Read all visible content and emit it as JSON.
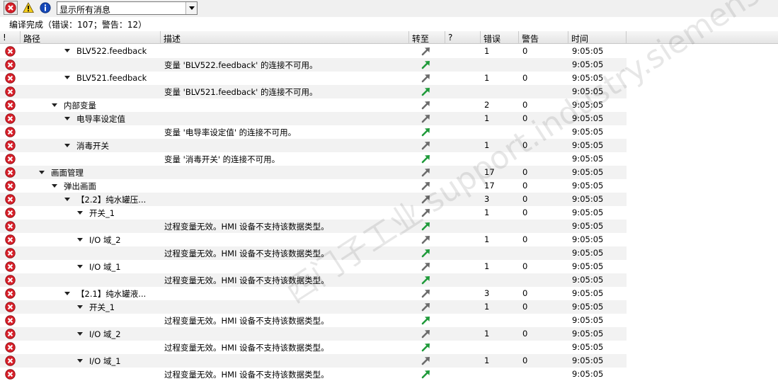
{
  "toolbar": {
    "filter_value": "显示所有消息",
    "buttons": [
      {
        "name": "error-filter-icon",
        "pressed": true
      },
      {
        "name": "warning-filter-icon",
        "pressed": false
      },
      {
        "name": "info-filter-icon",
        "pressed": false
      }
    ]
  },
  "summary": "编译完成（错误：107；警告：12）",
  "columns": {
    "bang": "!",
    "path": "路径",
    "description": "描述",
    "goto": "转至",
    "question": "?",
    "errors": "错误",
    "warnings": "警告",
    "time": "时间"
  },
  "watermark": "西门子工业 support.industry.siemens.com/cs",
  "rows": [
    {
      "path": "BLV522.feedback",
      "level": 4,
      "expand": true,
      "desc": "",
      "errors": "1",
      "warnings": "0",
      "time": "9:05:05",
      "goto": "grey"
    },
    {
      "path": "",
      "level": 0,
      "expand": false,
      "desc": "变量 'BLV522.feedback' 的连接不可用。",
      "errors": "",
      "warnings": "",
      "time": "9:05:05",
      "goto": "green"
    },
    {
      "path": "BLV521.feedback",
      "level": 4,
      "expand": true,
      "desc": "",
      "errors": "1",
      "warnings": "0",
      "time": "9:05:05",
      "goto": "grey"
    },
    {
      "path": "",
      "level": 0,
      "expand": false,
      "desc": "变量 'BLV521.feedback' 的连接不可用。",
      "errors": "",
      "warnings": "",
      "time": "9:05:05",
      "goto": "green"
    },
    {
      "path": "内部变量",
      "level": 3,
      "expand": true,
      "desc": "",
      "errors": "2",
      "warnings": "0",
      "time": "9:05:05",
      "goto": "grey"
    },
    {
      "path": "电导率设定值",
      "level": 4,
      "expand": true,
      "desc": "",
      "errors": "1",
      "warnings": "0",
      "time": "9:05:05",
      "goto": "grey"
    },
    {
      "path": "",
      "level": 0,
      "expand": false,
      "desc": "变量 '电导率设定值' 的连接不可用。",
      "errors": "",
      "warnings": "",
      "time": "9:05:05",
      "goto": "green"
    },
    {
      "path": "消毒开关",
      "level": 4,
      "expand": true,
      "desc": "",
      "errors": "1",
      "warnings": "0",
      "time": "9:05:05",
      "goto": "grey"
    },
    {
      "path": "",
      "level": 0,
      "expand": false,
      "desc": "变量 '消毒开关' 的连接不可用。",
      "errors": "",
      "warnings": "",
      "time": "9:05:05",
      "goto": "green"
    },
    {
      "path": "画面管理",
      "level": 2,
      "expand": true,
      "desc": "",
      "errors": "17",
      "warnings": "0",
      "time": "9:05:05",
      "goto": "grey"
    },
    {
      "path": "弹出画面",
      "level": 3,
      "expand": true,
      "desc": "",
      "errors": "17",
      "warnings": "0",
      "time": "9:05:05",
      "goto": "grey"
    },
    {
      "path": "【2.2】纯水罐压...",
      "level": 4,
      "expand": true,
      "desc": "",
      "errors": "3",
      "warnings": "0",
      "time": "9:05:05",
      "goto": "grey"
    },
    {
      "path": "开关_1",
      "level": 5,
      "expand": true,
      "desc": "",
      "errors": "1",
      "warnings": "0",
      "time": "9:05:05",
      "goto": "grey"
    },
    {
      "path": "",
      "level": 0,
      "expand": false,
      "desc": "过程变量无效。HMI 设备不支持该数据类型。",
      "errors": "",
      "warnings": "",
      "time": "9:05:05",
      "goto": "green"
    },
    {
      "path": "I/O 域_2",
      "level": 5,
      "expand": true,
      "desc": "",
      "errors": "1",
      "warnings": "0",
      "time": "9:05:05",
      "goto": "grey"
    },
    {
      "path": "",
      "level": 0,
      "expand": false,
      "desc": "过程变量无效。HMI 设备不支持该数据类型。",
      "errors": "",
      "warnings": "",
      "time": "9:05:05",
      "goto": "green"
    },
    {
      "path": "I/O 域_1",
      "level": 5,
      "expand": true,
      "desc": "",
      "errors": "1",
      "warnings": "0",
      "time": "9:05:05",
      "goto": "grey"
    },
    {
      "path": "",
      "level": 0,
      "expand": false,
      "desc": "过程变量无效。HMI 设备不支持该数据类型。",
      "errors": "",
      "warnings": "",
      "time": "9:05:05",
      "goto": "green"
    },
    {
      "path": "【2.1】纯水罐液...",
      "level": 4,
      "expand": true,
      "desc": "",
      "errors": "3",
      "warnings": "0",
      "time": "9:05:05",
      "goto": "grey"
    },
    {
      "path": "开关_1",
      "level": 5,
      "expand": true,
      "desc": "",
      "errors": "1",
      "warnings": "0",
      "time": "9:05:05",
      "goto": "grey"
    },
    {
      "path": "",
      "level": 0,
      "expand": false,
      "desc": "过程变量无效。HMI 设备不支持该数据类型。",
      "errors": "",
      "warnings": "",
      "time": "9:05:05",
      "goto": "green"
    },
    {
      "path": "I/O 域_2",
      "level": 5,
      "expand": true,
      "desc": "",
      "errors": "1",
      "warnings": "0",
      "time": "9:05:05",
      "goto": "grey"
    },
    {
      "path": "",
      "level": 0,
      "expand": false,
      "desc": "过程变量无效。HMI 设备不支持该数据类型。",
      "errors": "",
      "warnings": "",
      "time": "9:05:05",
      "goto": "green"
    },
    {
      "path": "I/O 域_1",
      "level": 5,
      "expand": true,
      "desc": "",
      "errors": "1",
      "warnings": "0",
      "time": "9:05:05",
      "goto": "grey"
    },
    {
      "path": "",
      "level": 0,
      "expand": false,
      "desc": "过程变量无效。HMI 设备不支持该数据类型。",
      "errors": "",
      "warnings": "",
      "time": "9:05:05",
      "goto": "green"
    }
  ]
}
